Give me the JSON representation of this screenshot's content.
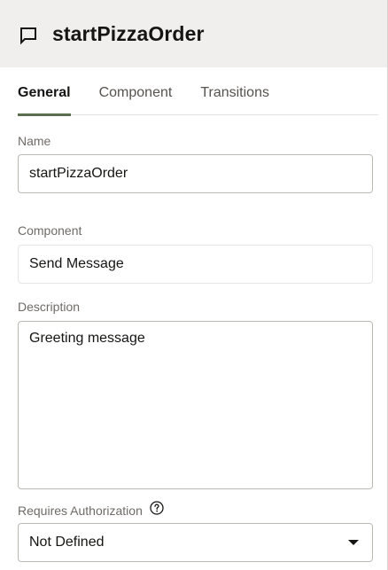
{
  "header": {
    "icon": "chat-bubble-icon",
    "title": "startPizzaOrder"
  },
  "tabs": [
    {
      "label": "General",
      "active": true
    },
    {
      "label": "Component",
      "active": false
    },
    {
      "label": "Transitions",
      "active": false
    }
  ],
  "form": {
    "name": {
      "label": "Name",
      "value": "startPizzaOrder"
    },
    "component": {
      "label": "Component",
      "value": "Send Message"
    },
    "description": {
      "label": "Description",
      "value": "Greeting message"
    },
    "requires_authorization": {
      "label": "Requires Authorization",
      "help_icon": "question-circle-icon",
      "value": "Not Defined"
    }
  },
  "colors": {
    "header_bg": "#f1efed",
    "active_tab_underline": "#5b6e4e",
    "label_text": "#6f6b66"
  }
}
